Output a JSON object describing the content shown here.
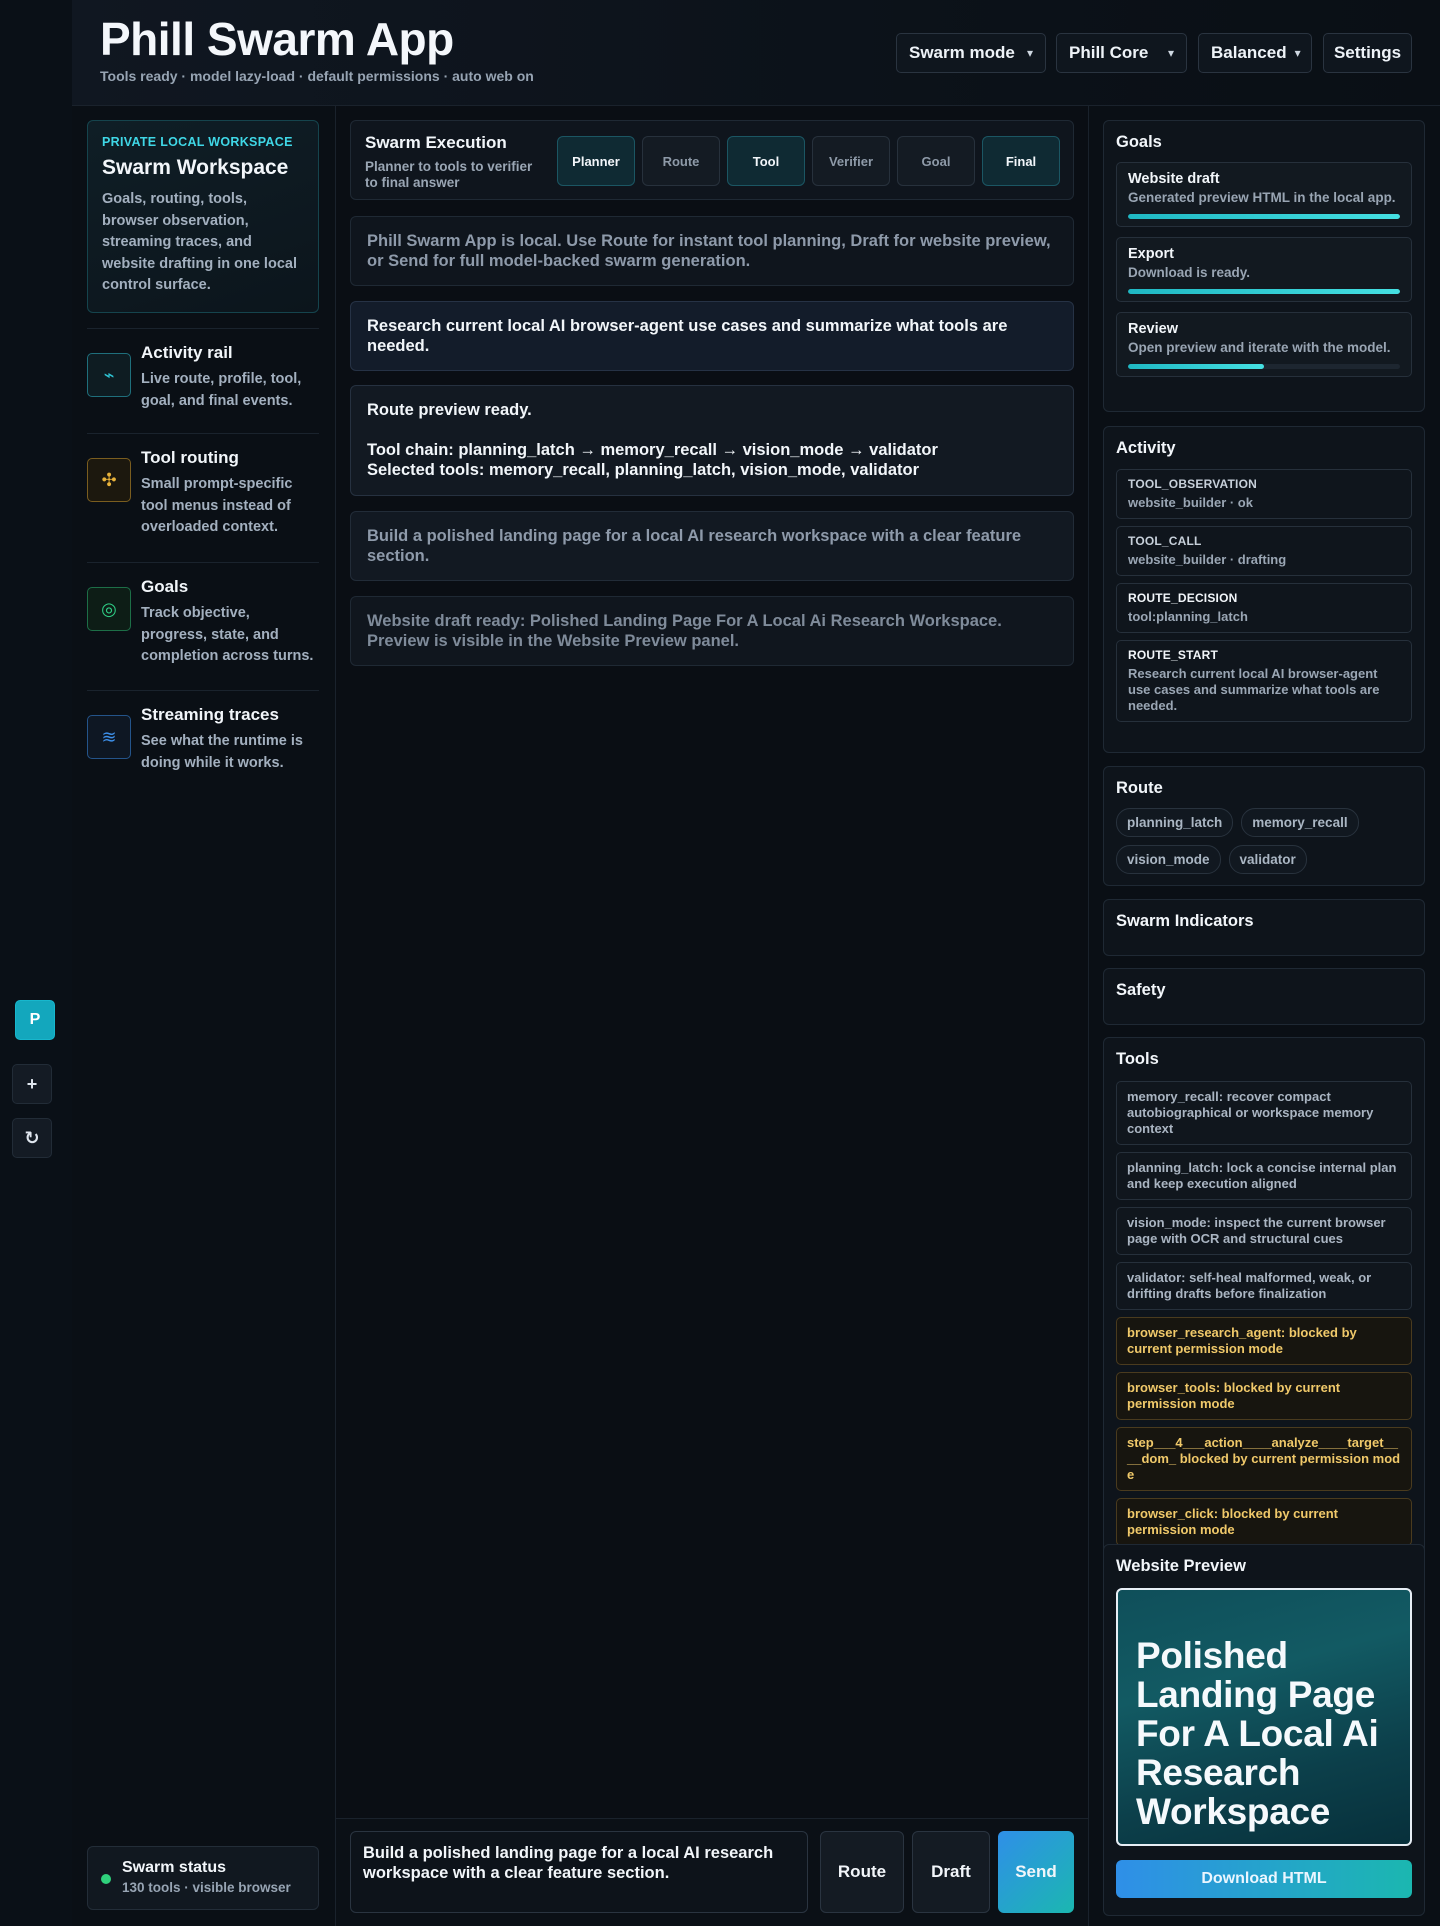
{
  "header": {
    "title": "Phill Swarm App",
    "subtitle": "Tools ready · model lazy-load · default permissions · auto web on",
    "mode_select": "Swarm mode",
    "model_select": "Phill Core",
    "profile_select": "Balanced",
    "settings_label": "Settings"
  },
  "rail": {
    "avatar_letter": "P"
  },
  "sidebar": {
    "workspace": {
      "kicker": "PRIVATE LOCAL WORKSPACE",
      "title": "Swarm Workspace",
      "description": "Goals, routing, tools, browser observation, streaming traces, and website drafting in one local control surface."
    },
    "features": [
      {
        "title": "Activity rail",
        "description": "Live route, profile, tool, goal, and final events.",
        "icon": "pulse-icon",
        "color": "#2fc6d6"
      },
      {
        "title": "Tool routing",
        "description": "Small prompt-specific tool menus instead of overloaded context.",
        "icon": "move-arrows-icon",
        "color": "#e8b23a"
      },
      {
        "title": "Goals",
        "description": "Track objective, progress, state, and completion across turns.",
        "icon": "target-icon",
        "color": "#2fcf86"
      },
      {
        "title": "Streaming traces",
        "description": "See what the runtime is doing while it works.",
        "icon": "wave-icon",
        "color": "#3d8fe8"
      }
    ],
    "status": {
      "title": "Swarm status",
      "subtitle": "130 tools · visible browser"
    }
  },
  "execution": {
    "title": "Swarm Execution",
    "subtitle": "Planner to tools to verifier to final answer",
    "steps": [
      {
        "label": "Planner",
        "active": true
      },
      {
        "label": "Route",
        "active": false
      },
      {
        "label": "Tool",
        "active": true
      },
      {
        "label": "Verifier",
        "active": false
      },
      {
        "label": "Goal",
        "active": false
      },
      {
        "label": "Final",
        "active": true
      }
    ]
  },
  "messages": {
    "info": "Phill Swarm App is local. Use Route for instant tool planning, Draft for website preview, or Send for full model-backed swarm generation.",
    "user1": "Research current local AI browser-agent use cases and summarize what tools are needed.",
    "bot1_line1": "Route preview ready.",
    "bot1_line2": "Tool chain: planning_latch → memory_recall → vision_mode → validator",
    "bot1_line3": "Selected tools: memory_recall, planning_latch, vision_mode, validator",
    "user2": "Build a polished landing page for a local AI research workspace with a clear feature section.",
    "bot2": "Website draft ready: Polished Landing Page For A Local Ai Research Workspace. Preview is visible in the Website Preview panel."
  },
  "composer": {
    "value": "Build a polished landing page for a local AI research workspace with a clear feature section.",
    "route_label": "Route",
    "draft_label": "Draft",
    "send_label": "Send"
  },
  "goals": {
    "title": "Goals",
    "items": [
      {
        "title": "Website draft",
        "description": "Generated preview HTML in the local app.",
        "progress": 1.0
      },
      {
        "title": "Export",
        "description": "Download is ready.",
        "progress": 1.0
      },
      {
        "title": "Review",
        "description": "Open preview and iterate with the model.",
        "progress": 0.5
      }
    ]
  },
  "activity": {
    "title": "Activity",
    "items": [
      {
        "event": "TOOL_OBSERVATION",
        "detail": "website_builder · ok"
      },
      {
        "event": "TOOL_CALL",
        "detail": "website_builder · drafting"
      },
      {
        "event": "ROUTE_DECISION",
        "detail": "tool:planning_latch"
      },
      {
        "event": "ROUTE_START",
        "detail": "Research current local AI browser-agent use cases and summarize what tools are needed."
      }
    ]
  },
  "route": {
    "title": "Route",
    "chips": [
      "planning_latch",
      "memory_recall",
      "vision_mode",
      "validator"
    ]
  },
  "indicators": {
    "title": "Swarm Indicators"
  },
  "safety": {
    "title": "Safety"
  },
  "tools": {
    "title": "Tools",
    "items": [
      {
        "text": "memory_recall: recover compact autobiographical or workspace memory context",
        "blocked": false
      },
      {
        "text": "planning_latch: lock a concise internal plan and keep execution aligned",
        "blocked": false
      },
      {
        "text": "vision_mode: inspect the current browser page with OCR and structural cues",
        "blocked": false
      },
      {
        "text": "validator: self-heal malformed, weak, or drifting drafts before finalization",
        "blocked": false
      },
      {
        "text": "browser_research_agent: blocked by current permission mode",
        "blocked": true
      },
      {
        "text": "browser_tools: blocked by current permission mode",
        "blocked": true
      },
      {
        "text": "step___4___action____analyze____target____dom_ blocked by current permission mode",
        "blocked": true
      },
      {
        "text": "browser_click: blocked by current permission mode",
        "blocked": true
      }
    ]
  },
  "preview": {
    "title": "Website Preview",
    "headline": "Polished Landing Page For A Local Ai Research Workspace",
    "download_label": "Download HTML"
  }
}
